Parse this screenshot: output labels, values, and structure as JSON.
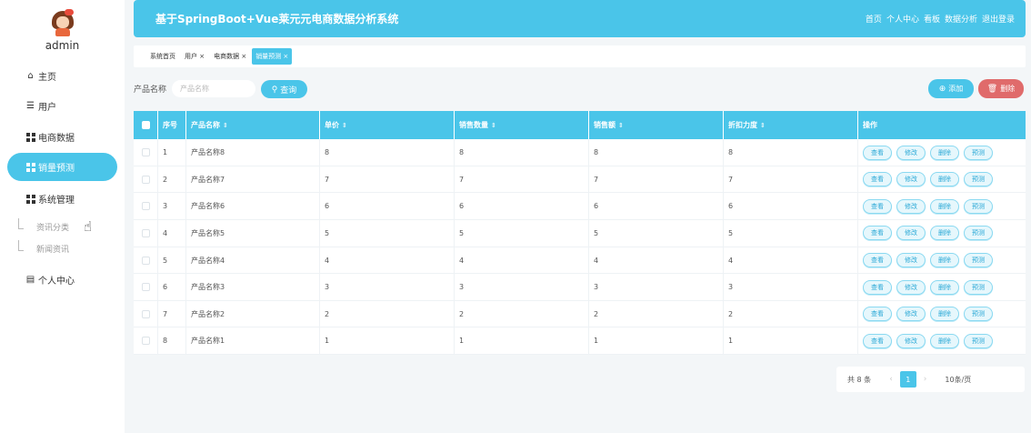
{
  "sidebar": {
    "username": "admin",
    "items": [
      {
        "label": "主页",
        "icon": "home-icon"
      },
      {
        "label": "用户",
        "icon": "list-icon"
      },
      {
        "label": "电商数据",
        "icon": "grid-icon"
      },
      {
        "label": "销量预测",
        "icon": "grid-icon"
      },
      {
        "label": "系统管理",
        "icon": "grid-icon"
      }
    ],
    "subitems": [
      "资讯分类",
      "新闻资讯"
    ],
    "personal": {
      "label": "个人中心",
      "icon": "window-icon"
    }
  },
  "header": {
    "title": "基于SpringBoot+Vue莱元元电商数据分析系统",
    "links": [
      "首页",
      "个人中心",
      "看板",
      "数据分析",
      "退出登录"
    ]
  },
  "tabs": [
    "系统首页",
    "用户 ×",
    "电商数据 ×",
    "销量预测 ×"
  ],
  "search": {
    "label": "产品名称",
    "placeholder": "产品名称",
    "query_button": "查询",
    "add_button": "添加",
    "delete_button": "删除"
  },
  "table": {
    "columns": [
      "序号",
      "产品名称",
      "单价",
      "销售数量",
      "销售额",
      "折扣力度",
      "操作"
    ],
    "rows": [
      [
        "1",
        "产品名称8",
        "8",
        "8",
        "8",
        "8"
      ],
      [
        "2",
        "产品名称7",
        "7",
        "7",
        "7",
        "7"
      ],
      [
        "3",
        "产品名称6",
        "6",
        "6",
        "6",
        "6"
      ],
      [
        "4",
        "产品名称5",
        "5",
        "5",
        "5",
        "5"
      ],
      [
        "5",
        "产品名称4",
        "4",
        "4",
        "4",
        "4"
      ],
      [
        "6",
        "产品名称3",
        "3",
        "3",
        "3",
        "3"
      ],
      [
        "7",
        "产品名称2",
        "2",
        "2",
        "2",
        "2"
      ],
      [
        "8",
        "产品名称1",
        "1",
        "1",
        "1",
        "1"
      ]
    ],
    "row_actions": [
      "查看",
      "修改",
      "删除",
      "预测"
    ]
  },
  "pagination": {
    "total": "共 8 条",
    "prev": "‹",
    "current": "1",
    "next": "›",
    "page_size": "10条/页"
  },
  "colors": {
    "primary": "#4ac5e9",
    "danger": "#e06b6b",
    "background": "#f3f6f8"
  }
}
